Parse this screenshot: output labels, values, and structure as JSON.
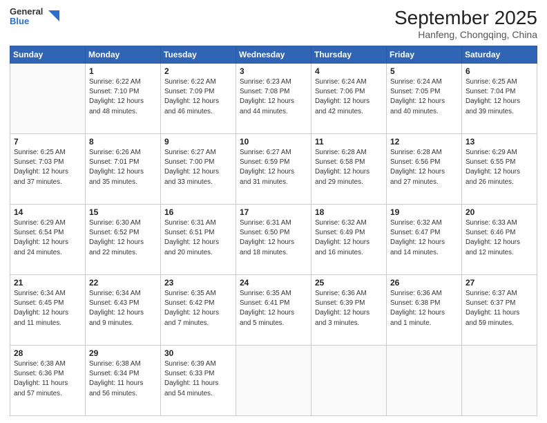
{
  "header": {
    "logo_general": "General",
    "logo_blue": "Blue",
    "month_title": "September 2025",
    "location": "Hanfeng, Chongqing, China"
  },
  "weekdays": [
    "Sunday",
    "Monday",
    "Tuesday",
    "Wednesday",
    "Thursday",
    "Friday",
    "Saturday"
  ],
  "weeks": [
    [
      {
        "day": "",
        "info": ""
      },
      {
        "day": "1",
        "info": "Sunrise: 6:22 AM\nSunset: 7:10 PM\nDaylight: 12 hours\nand 48 minutes."
      },
      {
        "day": "2",
        "info": "Sunrise: 6:22 AM\nSunset: 7:09 PM\nDaylight: 12 hours\nand 46 minutes."
      },
      {
        "day": "3",
        "info": "Sunrise: 6:23 AM\nSunset: 7:08 PM\nDaylight: 12 hours\nand 44 minutes."
      },
      {
        "day": "4",
        "info": "Sunrise: 6:24 AM\nSunset: 7:06 PM\nDaylight: 12 hours\nand 42 minutes."
      },
      {
        "day": "5",
        "info": "Sunrise: 6:24 AM\nSunset: 7:05 PM\nDaylight: 12 hours\nand 40 minutes."
      },
      {
        "day": "6",
        "info": "Sunrise: 6:25 AM\nSunset: 7:04 PM\nDaylight: 12 hours\nand 39 minutes."
      }
    ],
    [
      {
        "day": "7",
        "info": "Sunrise: 6:25 AM\nSunset: 7:03 PM\nDaylight: 12 hours\nand 37 minutes."
      },
      {
        "day": "8",
        "info": "Sunrise: 6:26 AM\nSunset: 7:01 PM\nDaylight: 12 hours\nand 35 minutes."
      },
      {
        "day": "9",
        "info": "Sunrise: 6:27 AM\nSunset: 7:00 PM\nDaylight: 12 hours\nand 33 minutes."
      },
      {
        "day": "10",
        "info": "Sunrise: 6:27 AM\nSunset: 6:59 PM\nDaylight: 12 hours\nand 31 minutes."
      },
      {
        "day": "11",
        "info": "Sunrise: 6:28 AM\nSunset: 6:58 PM\nDaylight: 12 hours\nand 29 minutes."
      },
      {
        "day": "12",
        "info": "Sunrise: 6:28 AM\nSunset: 6:56 PM\nDaylight: 12 hours\nand 27 minutes."
      },
      {
        "day": "13",
        "info": "Sunrise: 6:29 AM\nSunset: 6:55 PM\nDaylight: 12 hours\nand 26 minutes."
      }
    ],
    [
      {
        "day": "14",
        "info": "Sunrise: 6:29 AM\nSunset: 6:54 PM\nDaylight: 12 hours\nand 24 minutes."
      },
      {
        "day": "15",
        "info": "Sunrise: 6:30 AM\nSunset: 6:52 PM\nDaylight: 12 hours\nand 22 minutes."
      },
      {
        "day": "16",
        "info": "Sunrise: 6:31 AM\nSunset: 6:51 PM\nDaylight: 12 hours\nand 20 minutes."
      },
      {
        "day": "17",
        "info": "Sunrise: 6:31 AM\nSunset: 6:50 PM\nDaylight: 12 hours\nand 18 minutes."
      },
      {
        "day": "18",
        "info": "Sunrise: 6:32 AM\nSunset: 6:49 PM\nDaylight: 12 hours\nand 16 minutes."
      },
      {
        "day": "19",
        "info": "Sunrise: 6:32 AM\nSunset: 6:47 PM\nDaylight: 12 hours\nand 14 minutes."
      },
      {
        "day": "20",
        "info": "Sunrise: 6:33 AM\nSunset: 6:46 PM\nDaylight: 12 hours\nand 12 minutes."
      }
    ],
    [
      {
        "day": "21",
        "info": "Sunrise: 6:34 AM\nSunset: 6:45 PM\nDaylight: 12 hours\nand 11 minutes."
      },
      {
        "day": "22",
        "info": "Sunrise: 6:34 AM\nSunset: 6:43 PM\nDaylight: 12 hours\nand 9 minutes."
      },
      {
        "day": "23",
        "info": "Sunrise: 6:35 AM\nSunset: 6:42 PM\nDaylight: 12 hours\nand 7 minutes."
      },
      {
        "day": "24",
        "info": "Sunrise: 6:35 AM\nSunset: 6:41 PM\nDaylight: 12 hours\nand 5 minutes."
      },
      {
        "day": "25",
        "info": "Sunrise: 6:36 AM\nSunset: 6:39 PM\nDaylight: 12 hours\nand 3 minutes."
      },
      {
        "day": "26",
        "info": "Sunrise: 6:36 AM\nSunset: 6:38 PM\nDaylight: 12 hours\nand 1 minute."
      },
      {
        "day": "27",
        "info": "Sunrise: 6:37 AM\nSunset: 6:37 PM\nDaylight: 11 hours\nand 59 minutes."
      }
    ],
    [
      {
        "day": "28",
        "info": "Sunrise: 6:38 AM\nSunset: 6:36 PM\nDaylight: 11 hours\nand 57 minutes."
      },
      {
        "day": "29",
        "info": "Sunrise: 6:38 AM\nSunset: 6:34 PM\nDaylight: 11 hours\nand 56 minutes."
      },
      {
        "day": "30",
        "info": "Sunrise: 6:39 AM\nSunset: 6:33 PM\nDaylight: 11 hours\nand 54 minutes."
      },
      {
        "day": "",
        "info": ""
      },
      {
        "day": "",
        "info": ""
      },
      {
        "day": "",
        "info": ""
      },
      {
        "day": "",
        "info": ""
      }
    ]
  ]
}
